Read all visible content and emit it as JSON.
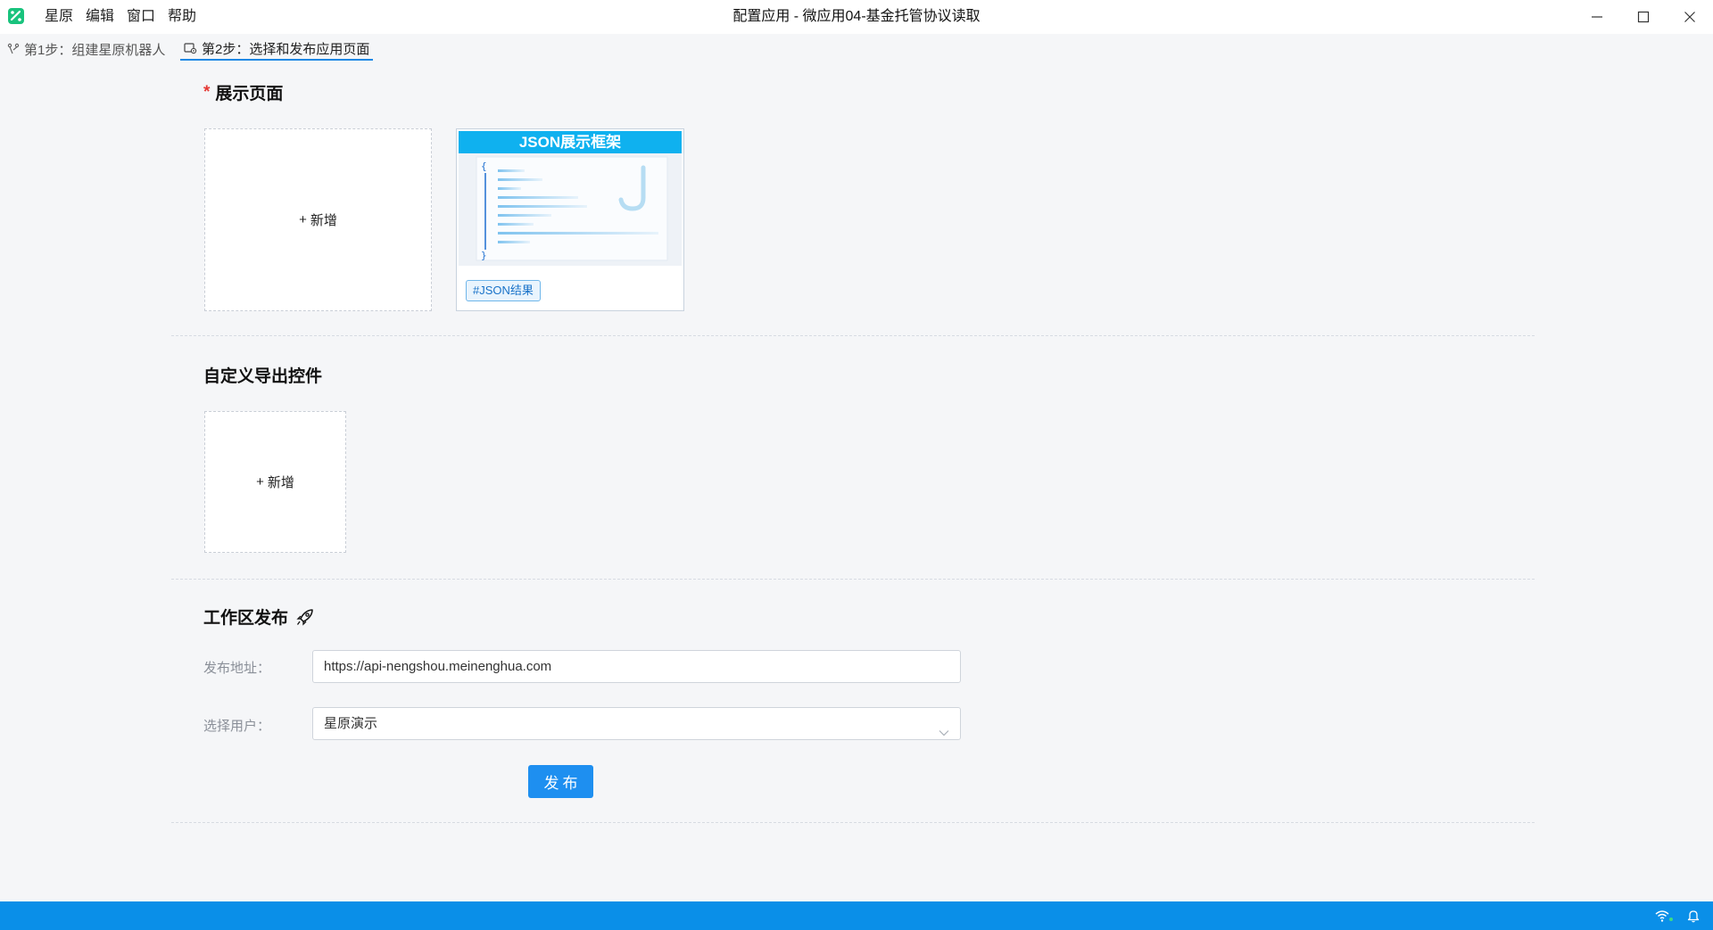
{
  "menu": [
    "星原",
    "编辑",
    "窗口",
    "帮助"
  ],
  "window": {
    "title": "配置应用 - 微应用04-基金托管协议读取"
  },
  "tabs": [
    {
      "label": "第1步：组建星原机器人",
      "icon": "branch-icon",
      "active": false
    },
    {
      "label": "第2步：选择和发布应用页面",
      "icon": "page-settings-icon",
      "active": true
    }
  ],
  "display_page": {
    "required_mark": "*",
    "title": "展示页面",
    "add_label": "新增",
    "add_plus": "+",
    "template": {
      "banner": "JSON展示框架",
      "tag": "#JSON结果"
    }
  },
  "custom_export": {
    "title": "自定义导出控件",
    "add_label": "新增",
    "add_plus": "+"
  },
  "publish": {
    "title": "工作区发布",
    "title_icon": "rocket-icon",
    "address_label": "发布地址：",
    "address_value": "https://api-nengshou.meinenghua.com",
    "user_label": "选择用户：",
    "user_value": "星原演示",
    "button_label": "发布"
  },
  "colors": {
    "accent": "#1e8ff0",
    "status_bar": "#0a8fe8",
    "required": "#e53935",
    "banner": "#0fb1ef"
  }
}
